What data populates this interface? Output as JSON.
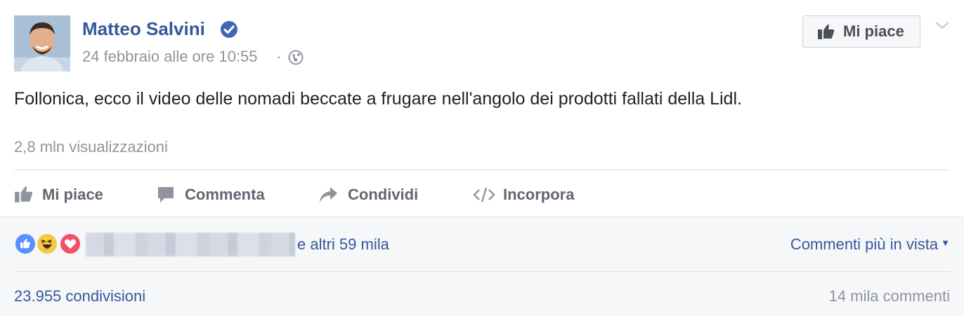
{
  "post": {
    "author": "Matteo Salvini",
    "timestamp": "24 febbraio alle ore 10:55",
    "separator": "·",
    "text": "Follonica, ecco il video delle nomadi beccate a frugare nell'angolo dei prodotti fallati della Lidl.",
    "views": "2,8 mln visualizzazioni"
  },
  "page_like_button": {
    "label": "Mi piace"
  },
  "actions": {
    "like": "Mi piace",
    "comment": "Commenta",
    "share": "Condividi",
    "embed": "Incorpora"
  },
  "reactions_bar": {
    "others": "e altri 59 mila",
    "top_comments": "Commenti più in vista",
    "shares": "23.955 condivisioni",
    "comments": "14 mila commenti"
  },
  "colors": {
    "link": "#365899",
    "secondary": "#90949c",
    "verified": "#4267b2"
  },
  "icons": [
    "verified-badge-icon",
    "globe-icon",
    "thumbs-up-icon",
    "chevron-down-icon",
    "comment-icon",
    "share-icon",
    "embed-icon",
    "like-reaction-icon",
    "haha-reaction-icon",
    "love-reaction-icon"
  ]
}
